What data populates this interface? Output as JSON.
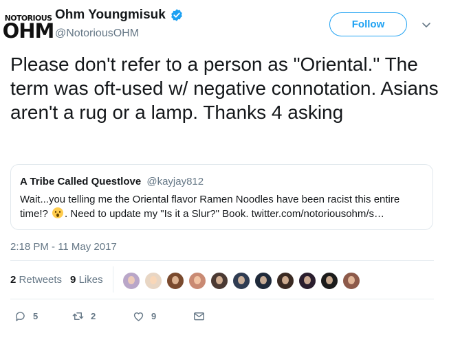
{
  "author": {
    "logo_top": "NOTORIOUS",
    "logo_bottom": "OHM",
    "name": "Ohm Youngmisuk",
    "handle": "@NotoriousOHM"
  },
  "follow_label": "Follow",
  "tweet": {
    "text": "Please don't refer to a person as \"Oriental.\" The term was oft-used w/ negative connotation. Asians aren't a rug or a lamp. Thanks 4 asking"
  },
  "quoted": {
    "name": "A Tribe Called Questlove",
    "handle": "@kayjay812",
    "text_before_emoji": "Wait...you telling me the Oriental flavor Ramen Noodles have been racist this entire time!?",
    "text_after_emoji": ". Need to update my \"Is it a Slur?\" Book. twitter.com/notoriousohm/s…"
  },
  "timestamp": "2:18 PM - 11 May 2017",
  "stats": {
    "retweets_count": "2",
    "retweets_label": "Retweets",
    "likes_count": "9",
    "likes_label": "Likes"
  },
  "likers": [
    {
      "color": "#b9a6c8"
    },
    {
      "color": "#e8d6c4"
    },
    {
      "color": "#7a4a2e"
    },
    {
      "color": "#c98a73"
    },
    {
      "color": "#4b3a33"
    },
    {
      "color": "#2f3c52"
    },
    {
      "color": "#1f2a3a"
    },
    {
      "color": "#3a2a22"
    },
    {
      "color": "#2a1e2e"
    },
    {
      "color": "#1c1c1c"
    },
    {
      "color": "#8d5a4a"
    }
  ],
  "actions": {
    "reply_count": "5",
    "retweet_count": "2",
    "like_count": "9"
  },
  "icons": {
    "verified": "verified-badge-icon",
    "caret": "chevron-down-icon",
    "reply": "reply-icon",
    "retweet": "retweet-icon",
    "like": "heart-icon",
    "dm": "envelope-icon"
  },
  "colors": {
    "accent": "#1da1f2",
    "secondary_text": "#657786",
    "border": "#e1e8ed"
  }
}
